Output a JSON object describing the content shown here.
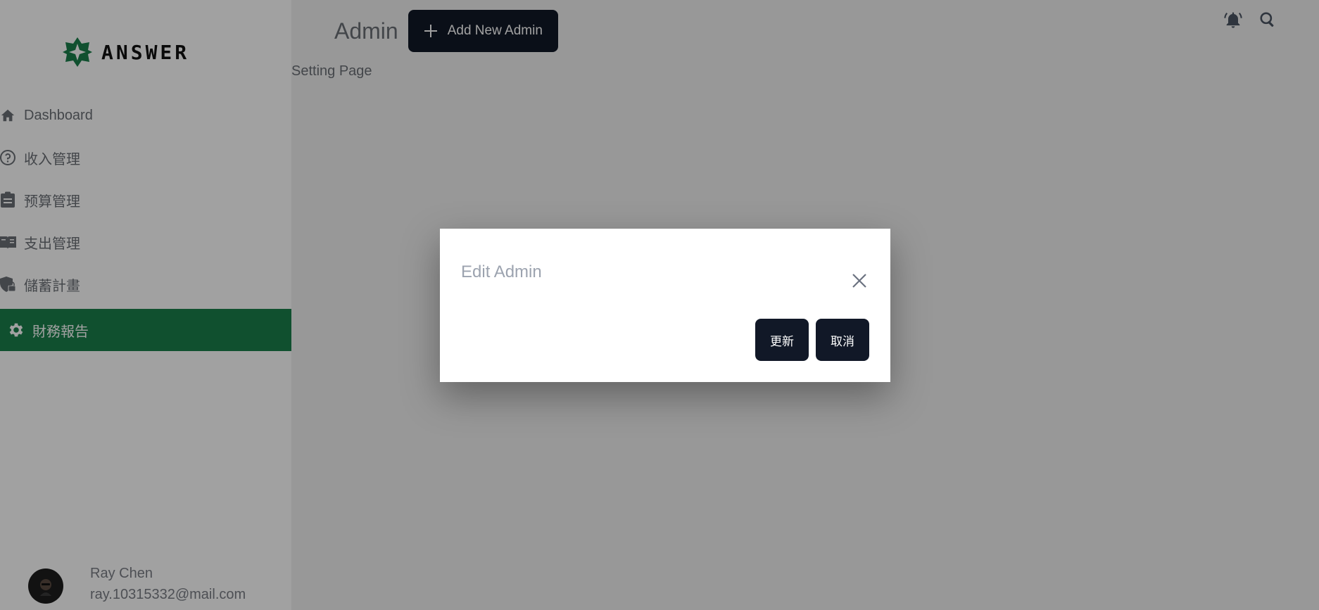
{
  "app": {
    "brand": "ANSWER"
  },
  "sidebar": {
    "items": [
      {
        "label": "Dashboard",
        "icon": "home-icon"
      },
      {
        "label": "收入管理",
        "icon": "question-circle-icon"
      },
      {
        "label": "预算管理",
        "icon": "clipboard-icon"
      },
      {
        "label": "支出管理",
        "icon": "book-icon"
      },
      {
        "label": "儲蓄計畫",
        "icon": "shield-lock-icon"
      },
      {
        "label": "財務報告",
        "icon": "gear-icon",
        "active": true
      }
    ]
  },
  "user": {
    "name": "Ray Chen",
    "email": "ray.10315332@mail.com"
  },
  "header": {
    "title": "Admin",
    "add_button_label": "Add New Admin",
    "subtitle": "Setting Page",
    "icons": [
      "bell-icon",
      "search-icon"
    ]
  },
  "modal": {
    "title": "Edit Admin",
    "update_label": "更新",
    "cancel_label": "取消"
  },
  "colors": {
    "accent": "#1a7f4b",
    "button_dark": "#111827",
    "overlay": "rgba(0,0,0,0.37)"
  }
}
